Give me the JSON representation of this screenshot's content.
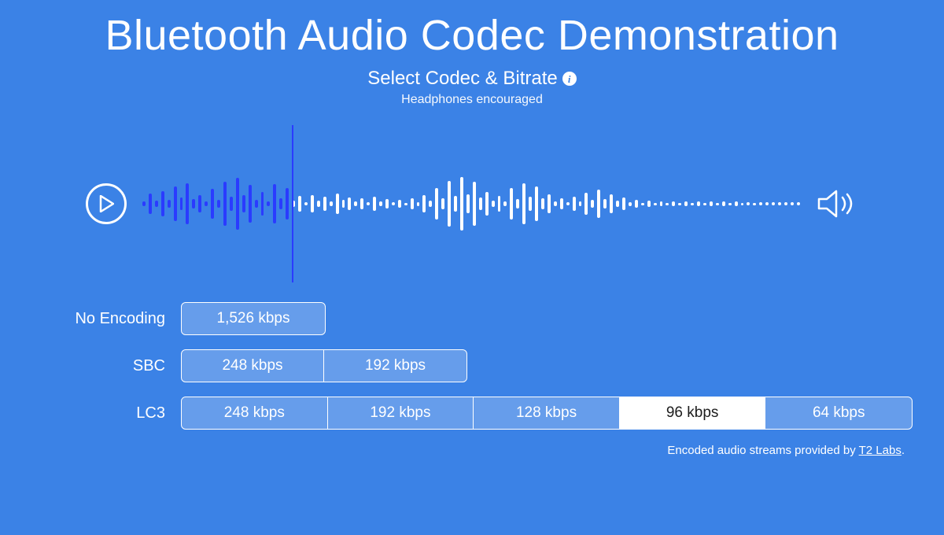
{
  "title": "Bluetooth Audio Codec Demonstration",
  "subtitle": "Select Codec & Bitrate",
  "note": "Headphones encouraged",
  "player": {
    "progress_bars": 24,
    "waveform": [
      6,
      26,
      8,
      32,
      10,
      44,
      16,
      52,
      12,
      22,
      6,
      38,
      10,
      56,
      18,
      66,
      22,
      48,
      10,
      30,
      6,
      50,
      14,
      40,
      8,
      20,
      4,
      22,
      8,
      18,
      6,
      26,
      10,
      16,
      6,
      14,
      4,
      18,
      6,
      12,
      4,
      10,
      3,
      14,
      5,
      22,
      8,
      40,
      14,
      58,
      20,
      68,
      24,
      56,
      16,
      30,
      8,
      20,
      6,
      40,
      12,
      52,
      18,
      44,
      14,
      24,
      6,
      14,
      4,
      18,
      6,
      28,
      10,
      36,
      12,
      24,
      8,
      16,
      5,
      10,
      3,
      8,
      3,
      6,
      2,
      6,
      2,
      6,
      2,
      6,
      2,
      6,
      2,
      6,
      2,
      6,
      2,
      4,
      2,
      4
    ],
    "tail_dots": 6
  },
  "rows": [
    {
      "label": "No Encoding",
      "options": [
        "1,526 kbps"
      ],
      "selected": -1,
      "widthClass": "w1",
      "stripWidth": 184
    },
    {
      "label": "SBC",
      "options": [
        "248 kbps",
        "192 kbps"
      ],
      "selected": -1,
      "widthClass": "w2",
      "stripWidth": 364
    },
    {
      "label": "LC3",
      "options": [
        "248 kbps",
        "192 kbps",
        "128 kbps",
        "96 kbps",
        "64 kbps"
      ],
      "selected": 3,
      "widthClass": "w5",
      "stripWidth": 970
    }
  ],
  "footer": {
    "prefix": "Encoded audio streams provided by ",
    "link": "T2 Labs",
    "suffix": "."
  },
  "info_glyph": "i"
}
